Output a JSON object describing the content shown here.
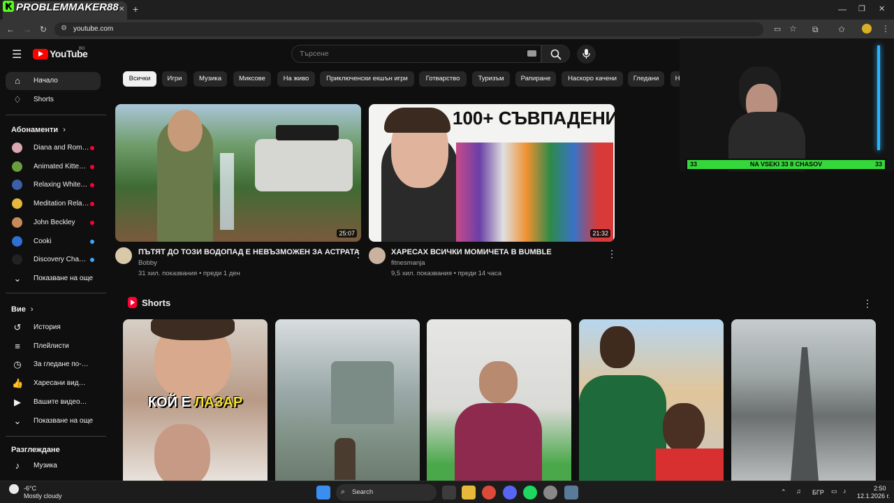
{
  "overlay": {
    "channel_logo": "PROBLEMMAKER88",
    "banner_left": "33",
    "banner_text": "NA VSEKI 33 8 CHASOV",
    "banner_right": "33"
  },
  "browser": {
    "url": "youtube.com",
    "new_tab": "+",
    "tab_close": "✕"
  },
  "youtube": {
    "logo": "YouTube",
    "region": "BG",
    "search_placeholder": "Търсене",
    "sidebar": {
      "home": "Начало",
      "shorts": "Shorts",
      "subscriptions_header": "Абонаменти",
      "subscriptions": [
        {
          "label": "Diana and Roma ...",
          "color": "#d9a8b0",
          "live": "red"
        },
        {
          "label": "Animated Kitten ...",
          "color": "#6a9e3d",
          "live": "red"
        },
        {
          "label": "Relaxing White N...",
          "color": "#3b5fa8",
          "live": "red"
        },
        {
          "label": "Meditation Relax...",
          "color": "#e6b83b",
          "live": "red"
        },
        {
          "label": "John Beckley",
          "color": "#c88a5a",
          "live": "red"
        },
        {
          "label": "Cooki",
          "color": "#2f6fd6",
          "live": "blue"
        },
        {
          "label": "Discovery Chann...",
          "color": "#222222",
          "live": "blue"
        }
      ],
      "show_more_1": "Показване на още",
      "you_header": "Вие",
      "you_items": [
        "История",
        "Плейлисти",
        "За гледане по-къс...",
        "Харесани видеокл...",
        "Вашите видеокли..."
      ],
      "show_more_2": "Показване на още",
      "explore_header": "Разглеждане",
      "explore_items": [
        "Музика"
      ]
    },
    "chips": [
      "Всички",
      "Игри",
      "Музика",
      "Миксове",
      "На живо",
      "Приключенски екшън игри",
      "Готварство",
      "Туризъм",
      "Рапиране",
      "Наскоро качени",
      "Гледани",
      "Н"
    ],
    "videos": [
      {
        "title": "ПЪТЯТ ДО ТОЗИ ВОДОПАД Е НЕВЪЗМОЖЕН ЗА АСТРАТА",
        "channel": "Bobby",
        "meta": "31 хил. показвания • преди 1 ден",
        "duration": "25:07"
      },
      {
        "title": "ХАРЕСАХ ВСИЧКИ МОМИЧЕТА В BUMBLE",
        "channel": "fitnesmanja",
        "meta": "9,5 хил. показвания • преди 14 часа",
        "duration": "21:32",
        "thumb_text": "100+ СЪВПАДЕНИЯ"
      }
    ],
    "shorts_header": "Shorts",
    "short_caption": {
      "part1": "КОЙ Е ",
      "part2": "ЛАЗАР"
    }
  },
  "taskbar": {
    "weather_temp": "-6°C",
    "weather_desc": "Mostly cloudy",
    "search": "Search",
    "lang": "БГР",
    "time": "2:50",
    "date": "12.1.2026 г."
  },
  "colors": {
    "accent": "#ff0000",
    "banner": "#35d83a",
    "active_chip": "#f1f1f1"
  }
}
